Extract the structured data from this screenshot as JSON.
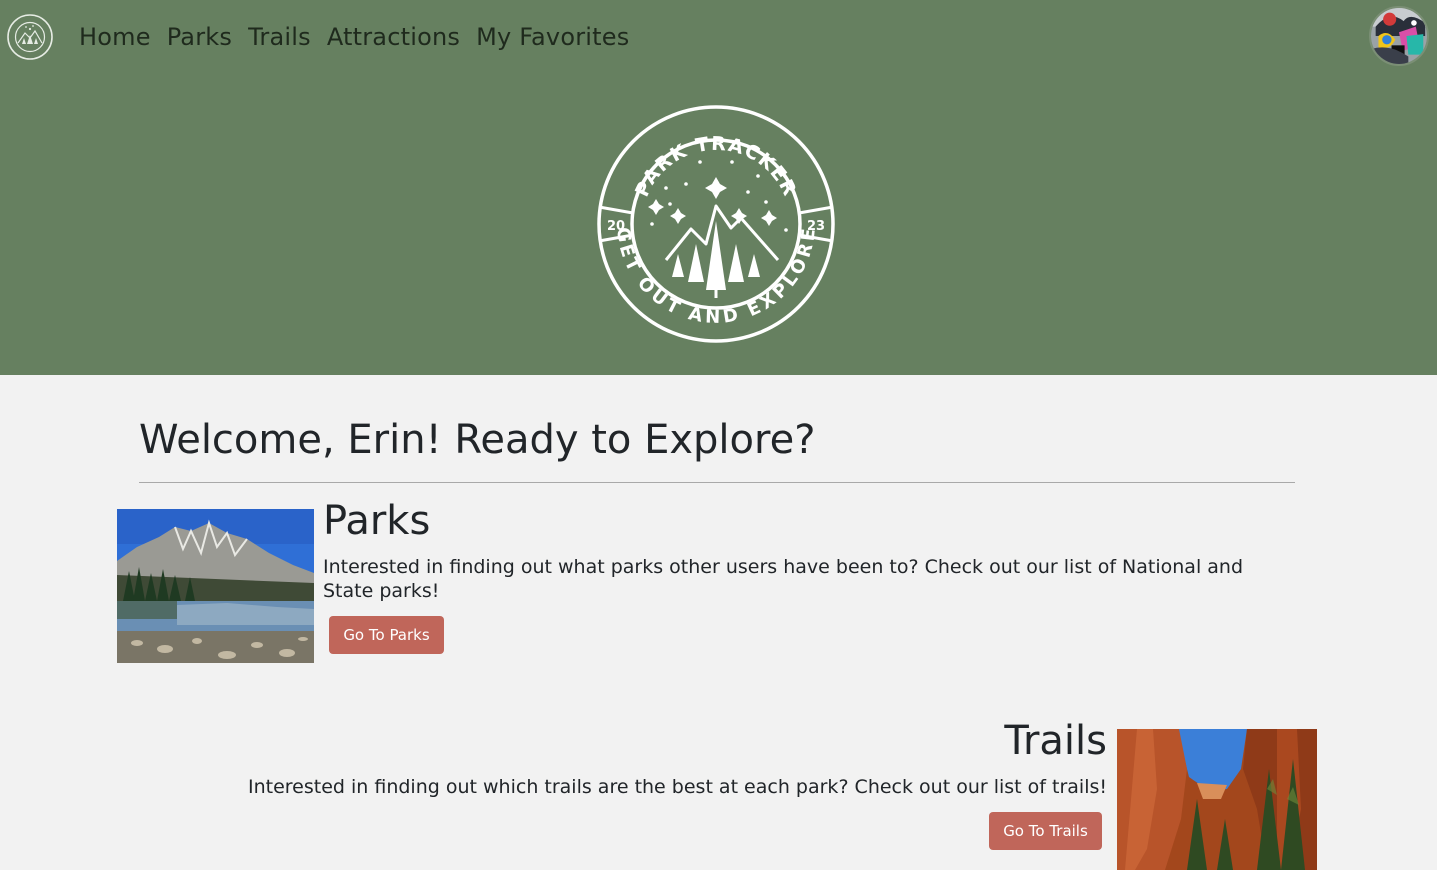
{
  "nav": {
    "links": [
      {
        "label": "Home"
      },
      {
        "label": "Parks"
      },
      {
        "label": "Trails"
      },
      {
        "label": "Attractions"
      },
      {
        "label": "My Favorites"
      }
    ]
  },
  "hero_logo": {
    "top_text": "PARK TRACKER",
    "bottom_text": "GET OUT AND EXPLORE",
    "year_left": "20",
    "year_right": "23"
  },
  "welcome": {
    "heading": "Welcome, Erin! Ready to Explore?"
  },
  "parks_section": {
    "title": "Parks",
    "description": "Interested in finding out what parks other users have been to? Check out our list of National and State parks!",
    "button_label": "Go To Parks"
  },
  "trails_section": {
    "title": "Trails",
    "description": "Interested in finding out which trails are the best at each park? Check out our list of trails!",
    "button_label": "Go To Trails"
  },
  "colors": {
    "header_bg": "#668060",
    "page_bg": "#f2f2f2",
    "button_bg": "#c0665a",
    "logo_stroke": "#ffffff"
  }
}
